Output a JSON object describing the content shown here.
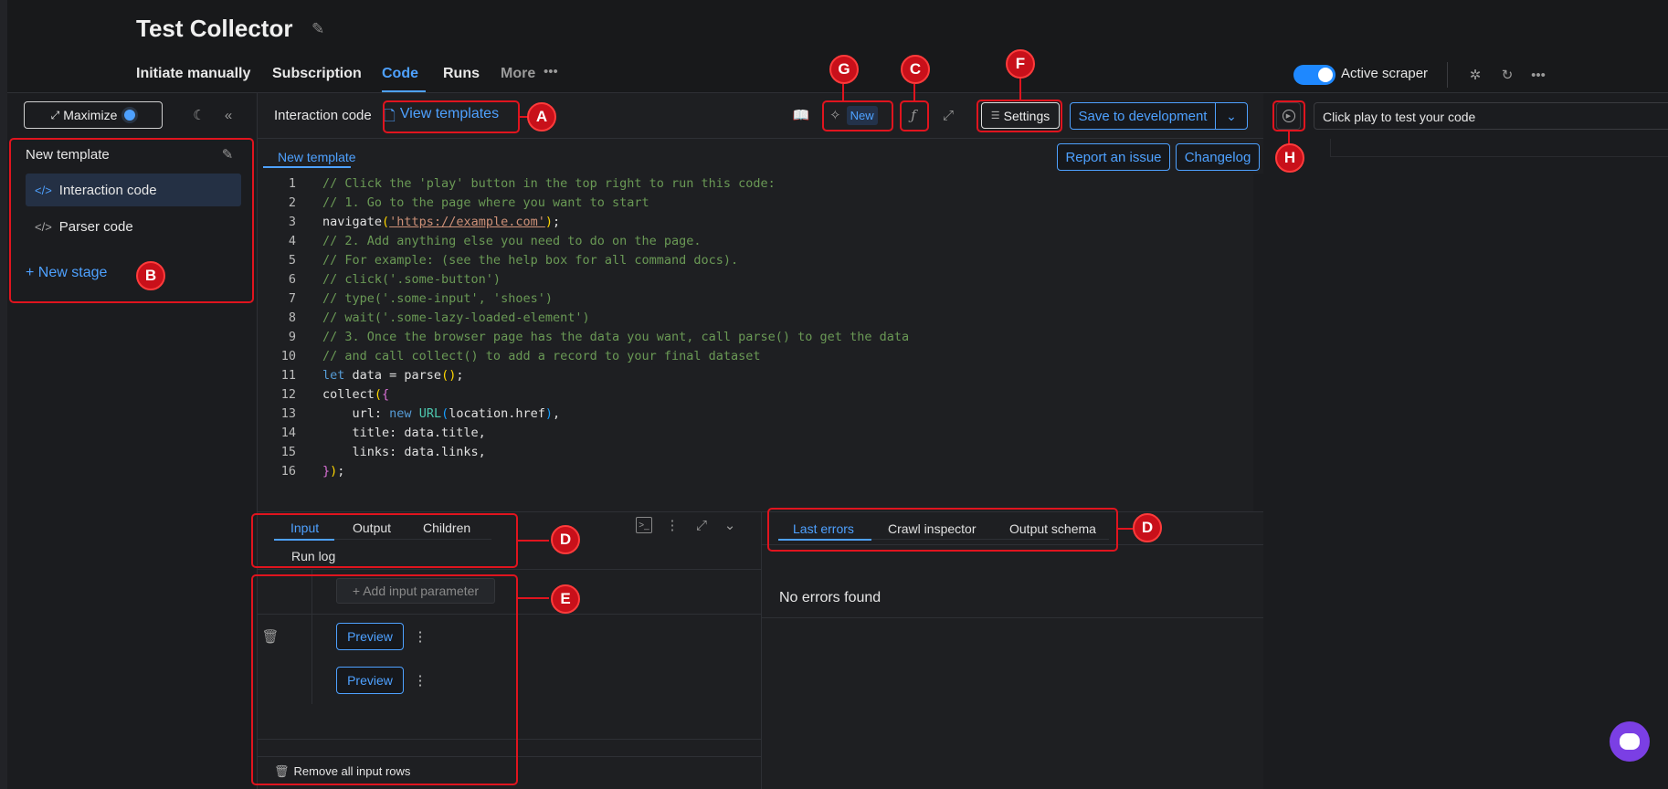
{
  "header": {
    "title": "Test Collector",
    "tabs": [
      "Initiate manually",
      "Subscription",
      "Code",
      "Runs",
      "More"
    ],
    "active_tab": "Code",
    "active_scraper_label": "Active scraper"
  },
  "sidebar": {
    "maximize_label": "Maximize",
    "template_name": "New template",
    "stages": [
      "Interaction code",
      "Parser code"
    ],
    "new_stage_label": "+ New stage"
  },
  "editor": {
    "label": "Interaction code",
    "view_templates": "View templates",
    "ai_new_badge": "New",
    "settings_label": "Settings",
    "save_label": "Save to development",
    "file_tab": "New template",
    "report_issue": "Report an issue",
    "changelog": "Changelog",
    "code": [
      [
        [
          "// Click the 'play' button in the top right to run this code:",
          "com"
        ]
      ],
      [
        [
          "// 1. Go to the page where you want to start",
          "com"
        ]
      ],
      [
        [
          "navigate",
          "def"
        ],
        [
          "(",
          "p1"
        ],
        [
          "'https://example.com'",
          "str"
        ],
        [
          ")",
          "p1"
        ],
        [
          ";",
          "def"
        ]
      ],
      [
        [
          "// 2. Add anything else you need to do on the page.",
          "com"
        ]
      ],
      [
        [
          "// For example: (see the help box for all command docs).",
          "com"
        ]
      ],
      [
        [
          "// click('.some-button')",
          "com"
        ]
      ],
      [
        [
          "// type('.some-input', 'shoes')",
          "com"
        ]
      ],
      [
        [
          "// wait('.some-lazy-loaded-element')",
          "com"
        ]
      ],
      [
        [
          "// 3. Once the browser page has the data you want, call parse() to get the data",
          "com"
        ]
      ],
      [
        [
          "// and call collect() to add a record to your final dataset",
          "com"
        ]
      ],
      [
        [
          "let",
          "kw"
        ],
        [
          " data = parse",
          "def"
        ],
        [
          "()",
          "p1"
        ],
        [
          ";",
          "def"
        ]
      ],
      [
        [
          "collect",
          "def"
        ],
        [
          "(",
          "p1"
        ],
        [
          "{",
          "p2"
        ]
      ],
      [
        [
          "    url: ",
          "def"
        ],
        [
          "new",
          "kw"
        ],
        [
          " ",
          "def"
        ],
        [
          "URL",
          "cls"
        ],
        [
          "(",
          "p3"
        ],
        [
          "location.href",
          "def"
        ],
        [
          ")",
          "p3"
        ],
        [
          ",",
          "def"
        ]
      ],
      [
        [
          "    title: data.title,",
          "def"
        ]
      ],
      [
        [
          "    links: data.links,",
          "def"
        ]
      ],
      [
        [
          "}",
          "p2"
        ],
        [
          ")",
          "p1"
        ],
        [
          ";",
          "def"
        ]
      ]
    ]
  },
  "bottom_left": {
    "tabs": [
      "Input",
      "Output",
      "Children",
      "Run log"
    ],
    "active_tab": "Input",
    "add_param": "+ Add input parameter",
    "preview_buttons": [
      "Preview",
      "Preview"
    ],
    "remove_all": "Remove all input rows"
  },
  "bottom_right": {
    "tabs": [
      "Last errors",
      "Crawl inspector",
      "Output schema"
    ],
    "active_tab": "Last errors",
    "message": "No errors found"
  },
  "run_panel": {
    "status_placeholder": "Click play to test your code"
  },
  "annotations": [
    "A",
    "B",
    "C",
    "D",
    "D",
    "E",
    "F",
    "G",
    "H"
  ]
}
